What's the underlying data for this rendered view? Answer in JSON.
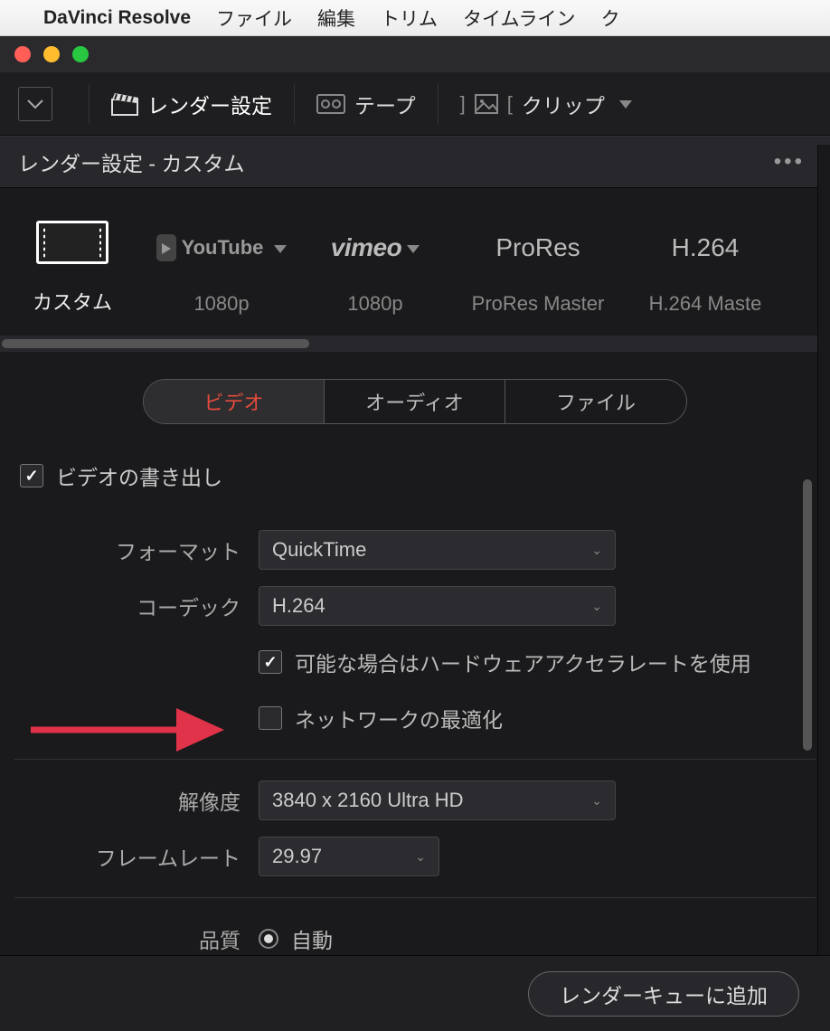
{
  "menubar": {
    "app_name": "DaVinci Resolve",
    "items": [
      "ファイル",
      "編集",
      "トリム",
      "タイムライン",
      "ク"
    ]
  },
  "toolbar": {
    "render_settings": "レンダー設定",
    "tape": "テープ",
    "clip": "クリップ"
  },
  "panel": {
    "title": "レンダー設定 - カスタム"
  },
  "presets": [
    {
      "label": "カスタム",
      "sub": ""
    },
    {
      "label": "1080p",
      "brand": "YouTube"
    },
    {
      "label": "1080p",
      "brand": "vimeo"
    },
    {
      "label": "ProRes Master",
      "brand": "ProRes"
    },
    {
      "label": "H.264 Maste",
      "brand": "H.264"
    }
  ],
  "tabs": {
    "video": "ビデオ",
    "audio": "オーディオ",
    "file": "ファイル"
  },
  "form": {
    "export_video": "ビデオの書き出し",
    "format_label": "フォーマット",
    "format_value": "QuickTime",
    "codec_label": "コーデック",
    "codec_value": "H.264",
    "hw_accel": "可能な場合はハードウェアアクセラレートを使用",
    "network_opt": "ネットワークの最適化",
    "resolution_label": "解像度",
    "resolution_value": "3840 x 2160 Ultra HD",
    "framerate_label": "フレームレート",
    "framerate_value": "29.97",
    "quality_label": "品質",
    "quality_value": "自動"
  },
  "footer": {
    "add_to_queue": "レンダーキューに追加"
  },
  "colors": {
    "accent": "#e64b3c"
  }
}
